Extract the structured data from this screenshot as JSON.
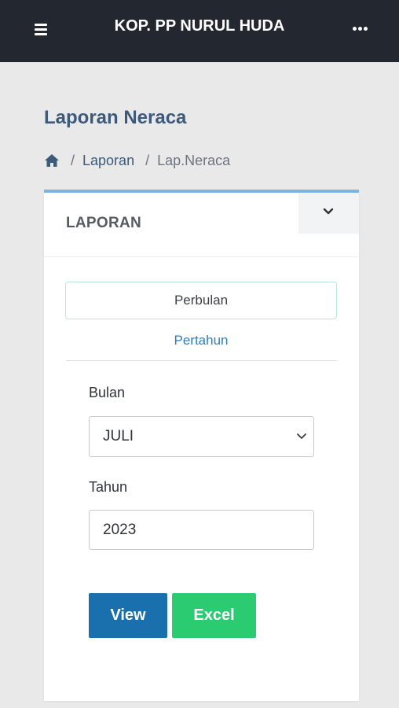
{
  "topbar": {
    "title": "KOP. PP NURUL HUDA",
    "menu_icon": "hamburger-icon",
    "more_icon": "more-horizontal-icon"
  },
  "page": {
    "title": "Laporan Neraca"
  },
  "breadcrumb": {
    "home_icon": "home-icon",
    "separator": "/",
    "items": [
      "Laporan",
      "Lap.Neraca"
    ]
  },
  "card": {
    "title": "LAPORAN",
    "collapse_icon": "chevron-down-icon",
    "tabs": [
      {
        "label": "Perbulan",
        "active": true
      },
      {
        "label": "Pertahun",
        "active": false
      }
    ],
    "form": {
      "month_label": "Bulan",
      "month_value": "JULI",
      "year_label": "Tahun",
      "year_value": "2023"
    },
    "buttons": {
      "view_label": "View",
      "excel_label": "Excel"
    }
  },
  "colors": {
    "topbar_bg": "#232830",
    "page_bg": "#e9e9e9",
    "title_color": "#3d5a7a",
    "card_accent": "#7fb2dc",
    "view_button": "#1a6fad",
    "excel_button": "#2bcb72",
    "tab_link": "#2b7fc3"
  }
}
